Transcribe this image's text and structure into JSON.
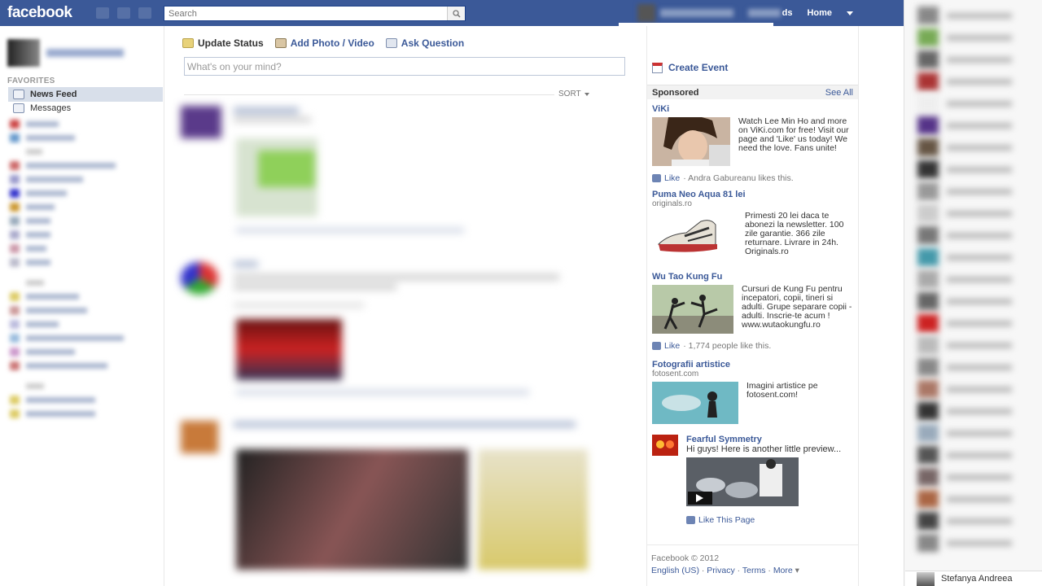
{
  "topbar": {
    "logo": "facebook",
    "search_placeholder": "Search",
    "find_friends_suffix": "ds",
    "home": "Home"
  },
  "left": {
    "favorites_header": "FAVORITES",
    "items": [
      {
        "label": "News Feed",
        "active": true
      },
      {
        "label": "Messages",
        "active": false
      }
    ]
  },
  "composer": {
    "update_status": "Update Status",
    "add_photo": "Add Photo / Video",
    "ask_question": "Ask Question",
    "placeholder": "What's on your mind?"
  },
  "feed": {
    "sort_label": "SORT"
  },
  "right": {
    "create_event": "Create Event",
    "sponsored": "Sponsored",
    "see_all": "See All",
    "ads": [
      {
        "title": "ViKi",
        "url": "",
        "text": "Watch Lee Min Ho and more on ViKi.com for free! Visit our page and 'Like' us today! We need the love. Fans unite!",
        "like": "Like",
        "social": "· Andra Gabureanu likes this."
      },
      {
        "title": "Puma Neo Aqua 81 lei",
        "url": "originals.ro",
        "text": "Primesti 20 lei daca te abonezi la newsletter. 100 zile garantie. 366 zile returnare. Livrare in 24h. Originals.ro",
        "like": "",
        "social": ""
      },
      {
        "title": "Wu Tao Kung Fu",
        "url": "",
        "text": "Cursuri de Kung Fu pentru incepatori, copii, tineri si adulti. Grupe separare copii - adulti. Inscrie-te acum ! www.wutaokungfu.ro",
        "like": "Like",
        "social": "· 1,774 people like this."
      },
      {
        "title": "Fotografii artistice",
        "url": "fotosent.com",
        "text": "Imagini artistice pe fotosent.com!",
        "like": "",
        "social": ""
      },
      {
        "title": "Fearful Symmetry",
        "url": "",
        "text": "Hi guys! Here is another little preview...",
        "like": "Like This Page",
        "social": ""
      }
    ],
    "footer": {
      "copyright": "Facebook © 2012",
      "links": [
        "English (US)",
        "Privacy",
        "Terms",
        "More"
      ]
    }
  },
  "chat": {
    "bottom_name": "Stefanya Andreea"
  }
}
